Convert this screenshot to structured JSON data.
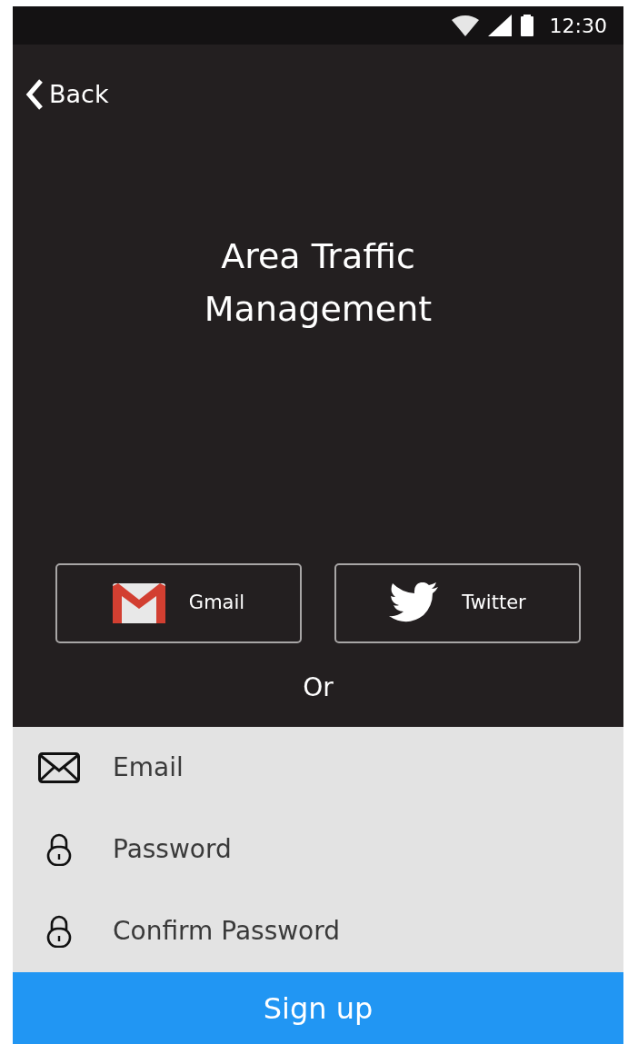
{
  "status_bar": {
    "time": "12:30"
  },
  "back": {
    "label": "Back"
  },
  "title": "Area Traffic Management",
  "social_buttons": [
    {
      "kind": "gmail",
      "label": "Gmail"
    },
    {
      "kind": "twitter",
      "label": "Twitter"
    }
  ],
  "separator": "Or",
  "fields": [
    {
      "kind": "email",
      "placeholder": "Email"
    },
    {
      "kind": "password",
      "placeholder": "Password"
    },
    {
      "kind": "password",
      "placeholder": "Confirm Password"
    }
  ],
  "submit": "Sign up"
}
